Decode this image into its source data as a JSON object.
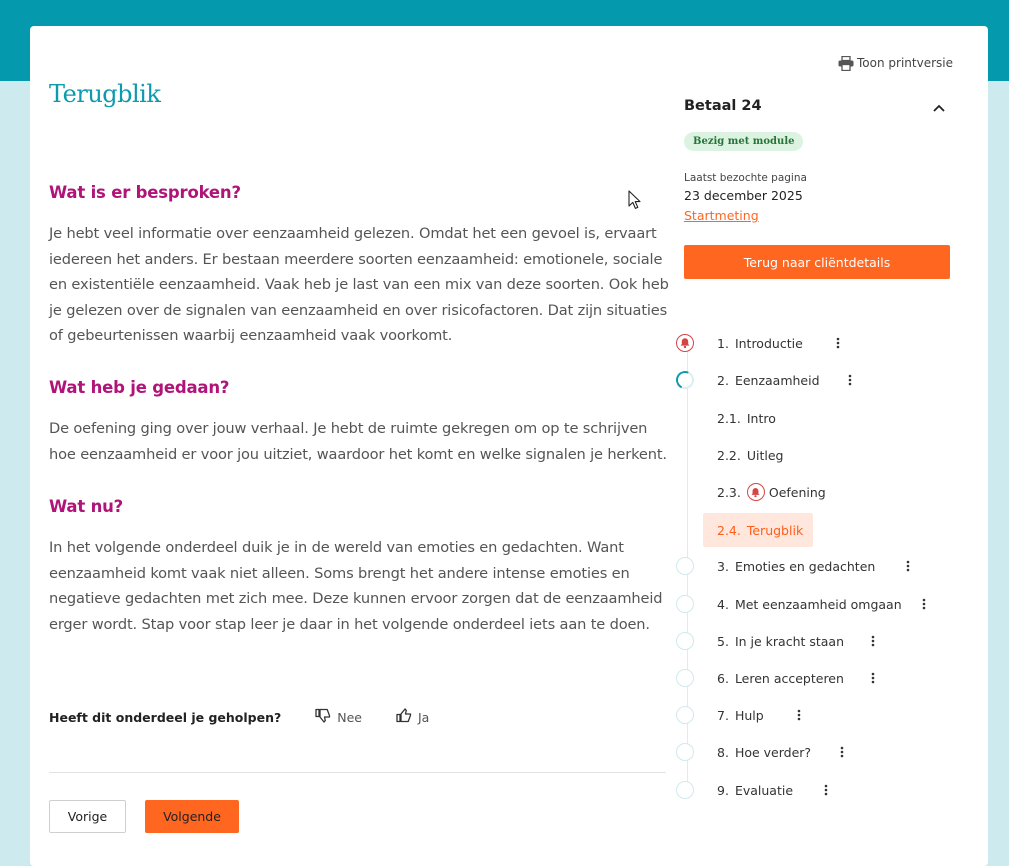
{
  "colors": {
    "brand_teal": "#0499ad",
    "accent_orange": "#ff6620",
    "heading_magenta": "#b01478",
    "status_green": "#27743a"
  },
  "print_link": {
    "icon": "printer-icon",
    "label": "Toon printversie"
  },
  "page_title": "Terugblik",
  "sections": [
    {
      "heading": "Wat is er besproken?",
      "body": "Je hebt veel informatie over eenzaamheid gelezen. Omdat het een gevoel is, ervaart iedereen het anders. Er bestaan meerdere soorten eenzaamheid: emotionele, sociale en existentiële eenzaamheid. Vaak heb je last van een mix van deze soorten. Ook heb je gelezen over de signalen van eenzaamheid en over risicofactoren. Dat zijn situaties of gebeurtenissen waarbij eenzaamheid vaak voorkomt."
    },
    {
      "heading": "Wat heb je gedaan?",
      "body": "De oefening ging over jouw verhaal. Je hebt de ruimte gekregen om op te schrijven hoe eenzaamheid er voor jou uitziet, waardoor het komt en welke signalen je herkent."
    },
    {
      "heading": "Wat nu?",
      "body": "In het volgende onderdeel duik je in de wereld van emoties en gedachten. Want eenzaamheid komt vaak niet alleen. Soms brengt het andere intense emoties en negatieve gedachten met zich mee. Deze kunnen ervoor zorgen dat de eenzaamheid erger wordt. Stap voor stap leer je daar in het volgende onderdeel iets aan te doen."
    }
  ],
  "feedback": {
    "question": "Heeft dit onderdeel je geholpen?",
    "no_label": "Nee",
    "yes_label": "Ja"
  },
  "navigation": {
    "prev_label": "Vorige",
    "next_label": "Volgende"
  },
  "sidebar": {
    "module_title": "Betaal 24",
    "status_badge": "Bezig met module",
    "last_visited_label": "Laatst bezochte pagina",
    "last_visited_date": "23 december 2025",
    "last_visited_link": "Startmeting",
    "back_button": "Terug naar cliëntdetails",
    "items": [
      {
        "num": "1.",
        "label": "Introductie",
        "state": "alert"
      },
      {
        "num": "2.",
        "label": "Eenzaamheid",
        "state": "in-progress",
        "children": [
          {
            "num": "2.1.",
            "label": "Intro"
          },
          {
            "num": "2.2.",
            "label": "Uitleg"
          },
          {
            "num": "2.3.",
            "label": "Oefening",
            "state": "alert"
          },
          {
            "num": "2.4.",
            "label": "Terugblik",
            "state": "active"
          }
        ]
      },
      {
        "num": "3.",
        "label": "Emoties en gedachten",
        "state": "not-started"
      },
      {
        "num": "4.",
        "label": "Met eenzaamheid omgaan",
        "state": "not-started"
      },
      {
        "num": "5.",
        "label": "In je kracht staan",
        "state": "not-started"
      },
      {
        "num": "6.",
        "label": "Leren accepteren",
        "state": "not-started"
      },
      {
        "num": "7.",
        "label": "Hulp",
        "state": "not-started"
      },
      {
        "num": "8.",
        "label": "Hoe verder?",
        "state": "not-started"
      },
      {
        "num": "9.",
        "label": "Evaluatie",
        "state": "not-started"
      }
    ]
  }
}
